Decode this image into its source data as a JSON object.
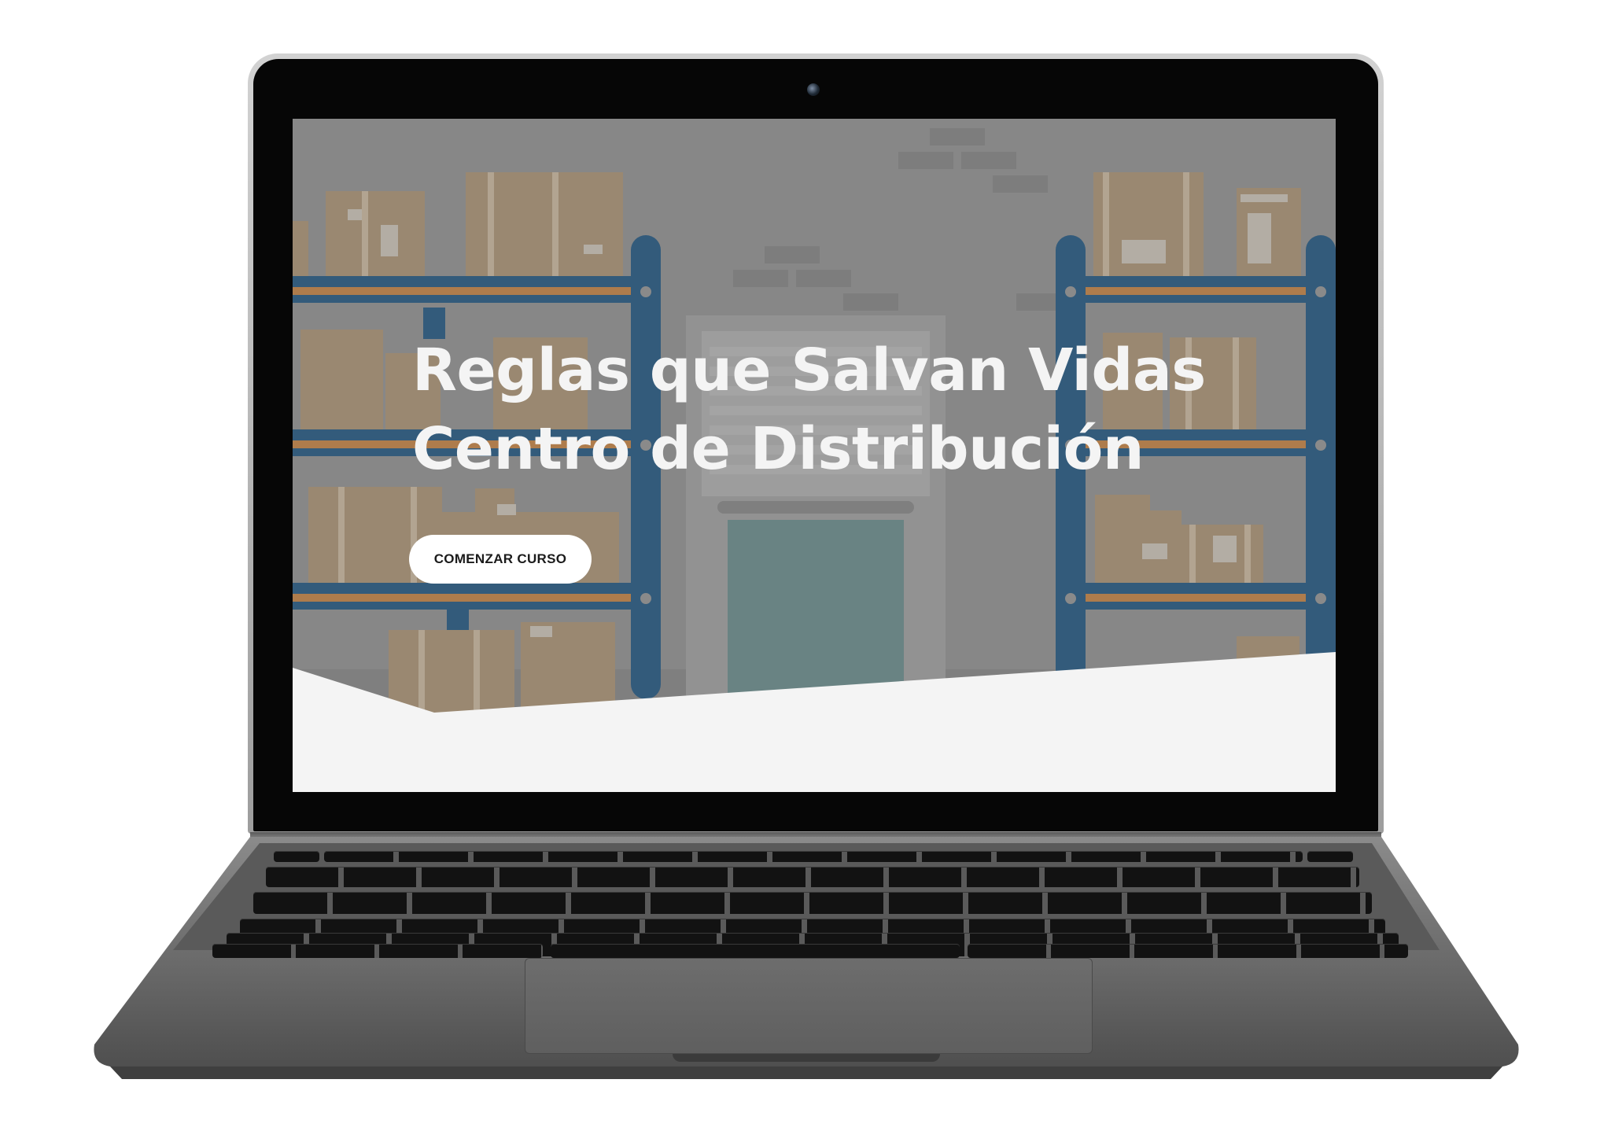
{
  "hero": {
    "title_line1": "Reglas que Salvan Vidas",
    "title_line2": "Centro de Distribución",
    "cta_label": "COMENZAR CURSO"
  },
  "colors": {
    "shelf_blue": "#124b79",
    "shelf_orange": "#c27a35",
    "box_tan": "#a58b6a",
    "door_teal": "#5f8485",
    "wave_white": "#f4f4f4",
    "cta_bg": "#ffffff"
  },
  "icons": {
    "camera": "camera-icon"
  }
}
